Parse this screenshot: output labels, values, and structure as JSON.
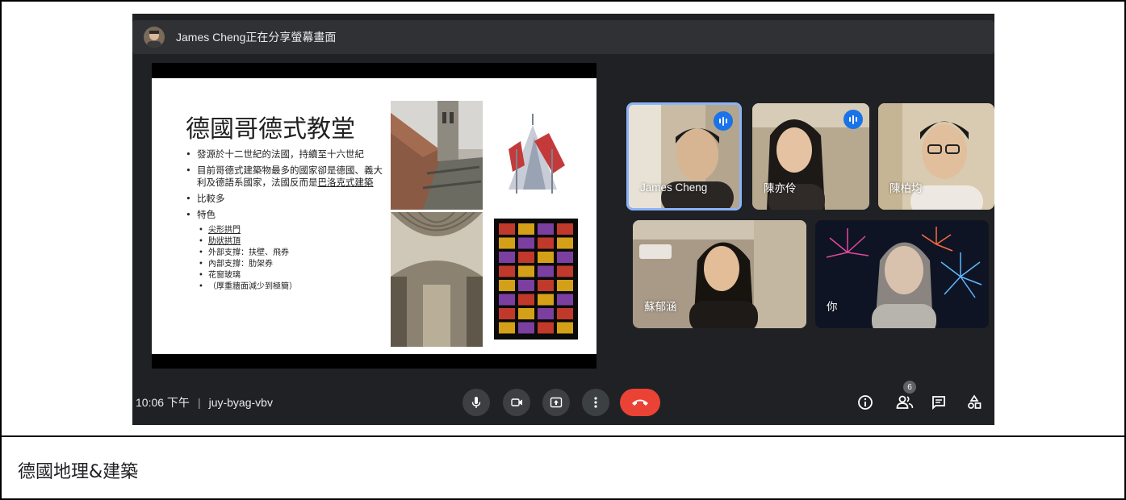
{
  "share_bar": {
    "text": "James Cheng正在分享螢幕畫面"
  },
  "slide": {
    "title": "德國哥德式教堂",
    "bullets": [
      "發源於十二世紀的法國，持續至十六世紀",
      "目前哥德式建築物最多的國家卻是德國、義大利及德語系國家，法國反而是",
      "巴洛克式建築",
      "比較多",
      "特色"
    ],
    "sub_bullets": [
      "尖形拱門",
      "肋狀拱頂",
      "外部支撐：扶壁、飛券",
      "內部支撐：肋架券",
      "花窗玻璃",
      "（厚重牆面減少到極簡）"
    ]
  },
  "participants": [
    {
      "name": "James Cheng",
      "speaking": true
    },
    {
      "name": "陳亦伶",
      "speaking": true
    },
    {
      "name": "陳柏均",
      "speaking": false
    },
    {
      "name": "蘇郁涵",
      "speaking": false
    },
    {
      "name": "你",
      "speaking": false
    }
  ],
  "bottom_bar": {
    "time": "10:06 下午",
    "separator": "|",
    "meeting_code": "juy-byag-vbv",
    "people_count": "6"
  },
  "caption": "德國地理&建築",
  "icons": [
    "mic-icon",
    "camera-icon",
    "present-icon",
    "more-icon",
    "end-call-icon",
    "info-icon",
    "people-icon",
    "chat-icon",
    "activities-icon"
  ],
  "colors": {
    "meet_bg": "#202124",
    "control_bg": "#3c4043",
    "end_call": "#ea4335",
    "speaking_ring": "#8ab4f8",
    "speaking_badge": "#1a73e8"
  }
}
